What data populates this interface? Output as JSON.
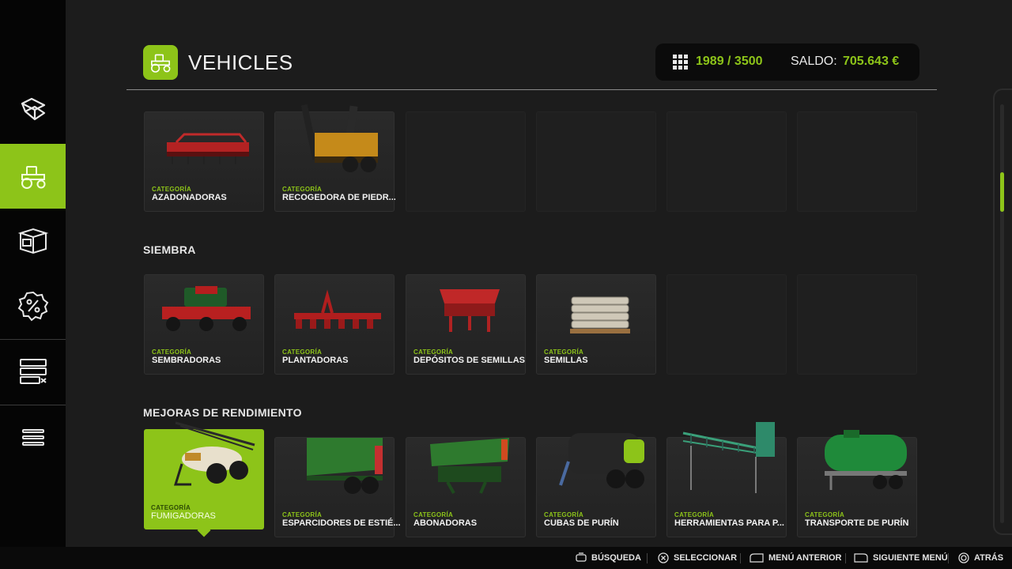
{
  "header": {
    "title": "VEHICLES",
    "count": "1989 / 3500",
    "saldo_label": "SALDO:",
    "saldo_value": "705.643 €"
  },
  "sections": [
    {
      "title": "",
      "cards": [
        {
          "category": "CATEGORÍA",
          "name": "AZADONADORAS"
        },
        {
          "category": "CATEGORÍA",
          "name": "RECOGEDORA DE PIEDR..."
        }
      ]
    },
    {
      "title": "SIEMBRA",
      "cards": [
        {
          "category": "CATEGORÍA",
          "name": "SEMBRADORAS"
        },
        {
          "category": "CATEGORÍA",
          "name": "PLANTADORAS"
        },
        {
          "category": "CATEGORÍA",
          "name": "DEPÓSITOS DE SEMILLAS"
        },
        {
          "category": "CATEGORÍA",
          "name": "SEMILLAS"
        }
      ]
    },
    {
      "title": "MEJORAS DE RENDIMIENTO",
      "cards": [
        {
          "category": "CATEGORÍA",
          "name": "FUMIGADORAS"
        },
        {
          "category": "CATEGORÍA",
          "name": "ESPARCIDORES DE ESTIÉ..."
        },
        {
          "category": "CATEGORÍA",
          "name": "ABONADORAS"
        },
        {
          "category": "CATEGORÍA",
          "name": "CUBAS DE PURÍN"
        },
        {
          "category": "CATEGORÍA",
          "name": "HERRAMIENTAS PARA P..."
        },
        {
          "category": "CATEGORÍA",
          "name": "TRANSPORTE DE PURÍN"
        }
      ]
    }
  ],
  "bottom_bar": {
    "search": "BÚSQUEDA",
    "select": "SELECCIONAR",
    "prev_menu": "MENÚ ANTERIOR",
    "next_menu": "SIGUIENTE MENÚ",
    "back": "ATRÁS"
  },
  "sidebar_icons": [
    "map-icon",
    "tractor-icon",
    "shop-box-icon",
    "discount-icon",
    "server-icon",
    "menu-icon"
  ],
  "colors": {
    "accent": "#8dc419",
    "background": "#1c1c1c",
    "sidebar": "#050505"
  }
}
